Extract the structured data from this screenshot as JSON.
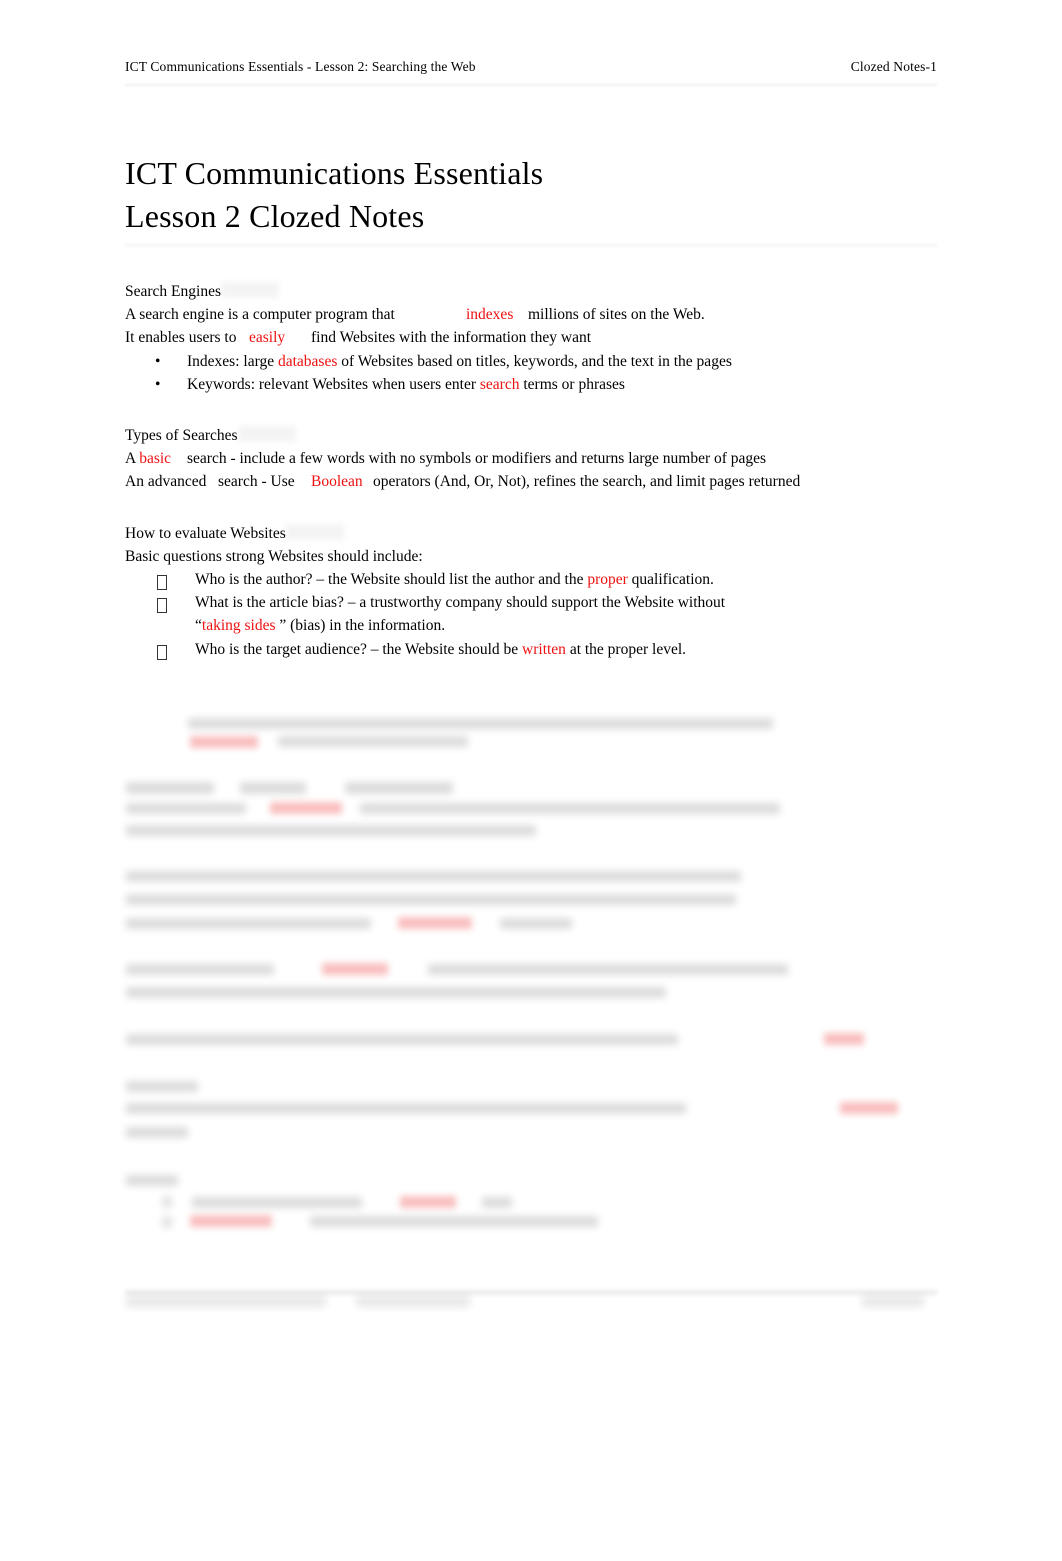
{
  "header": {
    "left": "ICT Communications Essentials - Lesson 2: Searching the Web",
    "right": "Clozed Notes-1"
  },
  "title": {
    "line1": "ICT Communications Essentials",
    "line2": "Lesson 2 Clozed Notes"
  },
  "sections": {
    "search_engines": {
      "heading": "Search Engines",
      "p1_before": "A search engine is a computer program that",
      "p1_blank": "indexes",
      "p1_after": "millions of sites on the Web.",
      "p2_before": "It enables users to",
      "p2_blank": "easily",
      "p2_after": "find Websites with the information they want",
      "bullets": [
        {
          "marker": "•",
          "before": "Indexes: large",
          "blank": "databases",
          "after": "of Websites based on titles, keywords, and the text in the pages"
        },
        {
          "marker": "•",
          "before": "Keywords: relevant Websites when users enter",
          "blank": "search",
          "after": "terms or phrases"
        }
      ]
    },
    "types_of_searches": {
      "heading": "Types of Searches",
      "p1_prefix": "A",
      "p1_blank": "basic",
      "p1_after": "search - include a few words with no symbols or modifiers and returns large number of pages",
      "p2_prefix": "An",
      "p2_word": "advanced",
      "p2_mid": "search - Use",
      "p2_blank": "Boolean",
      "p2_after": "operators (And, Or, Not), refines the search, and limit pages returned"
    },
    "evaluate_websites": {
      "heading": "How to evaluate Websites",
      "lead": "Basic questions strong Websites should include:",
      "bullets": [
        {
          "marker": "tofu",
          "before": "Who is the author? – the Website should list the author and the",
          "blank": "proper",
          "after": "qualification."
        },
        {
          "marker": "tofu",
          "before": "What is the article bias? – a trustworthy company should support the Website without",
          "quote_open": "“",
          "blank": "taking sides",
          "after": "” (bias) in the information."
        },
        {
          "marker": "tofu",
          "before": "Who is the target audience? – the Website should be",
          "blank": "written",
          "after": "at the proper level."
        }
      ]
    }
  },
  "colors": {
    "blank_answer": "#ee1111",
    "body_text": "#000000",
    "page_background": "#ffffff"
  },
  "obscured_region": {
    "note": "Lower portion of the page is blurred and illegible in the source scan."
  }
}
